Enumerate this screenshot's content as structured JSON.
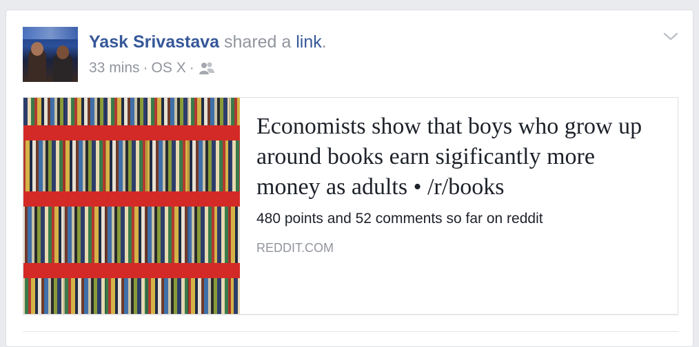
{
  "post": {
    "author": "Yask Srivastava",
    "action_text": " shared a ",
    "action_link": "link",
    "action_end": ".",
    "time": "33 mins",
    "separator": "·",
    "source": "OS X",
    "audience_icon": "friends-icon",
    "menu_icon": "chevron-down-icon"
  },
  "attachment": {
    "title": "Economists show that boys who grow up around books earn sigificantly more money as adults • /r/books",
    "description": "480 points and 52 comments so far on reddit",
    "domain": "REDDIT.COM",
    "thumbnail": "bookshelf-image"
  },
  "colors": {
    "link": "#365899",
    "meta": "#90949c",
    "text": "#1d2129"
  }
}
